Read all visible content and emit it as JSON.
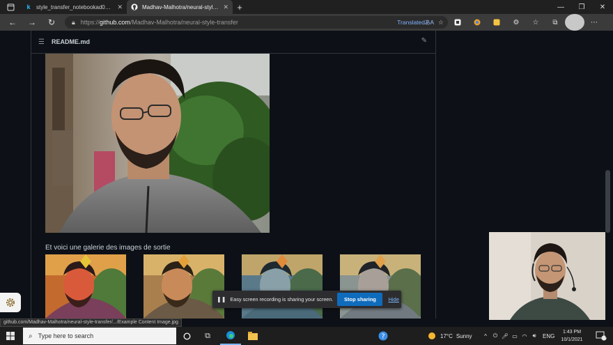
{
  "browser": {
    "tabs": [
      {
        "title": "style_transfer_notebookad03d61",
        "favicon": "k",
        "active": false
      },
      {
        "title": "Madhav-Malhotra/neural-style-t",
        "favicon": "github",
        "active": true
      }
    ],
    "new_tab_label": "+",
    "address": {
      "protocol": "https://",
      "host": "github.com",
      "path": "/Madhav-Malhotra/neural-style-transfer",
      "translated_label": "Translated"
    }
  },
  "readme": {
    "file_name": "README.md",
    "gallery_heading": "Et voici une galerie des images de sortie"
  },
  "share_bar": {
    "message": "Easy screen recording is sharing your screen.",
    "stop_label": "Stop sharing",
    "hide_label": "Hide"
  },
  "status_url": "github.com/Madhav-Malhotra/neural-style-transfer/.../Example Content Image.jpg",
  "taskbar": {
    "search_placeholder": "Type here to search",
    "weather_temp": "17°C",
    "weather_text": "Sunny",
    "language": "ENG",
    "time": "1:43 PM",
    "date": "10/1/2021",
    "notification_count": "21"
  },
  "colors": {
    "page_bg": "#0d1117",
    "accent_blue": "#0f6cbd",
    "link_blue": "#79b8ff"
  }
}
